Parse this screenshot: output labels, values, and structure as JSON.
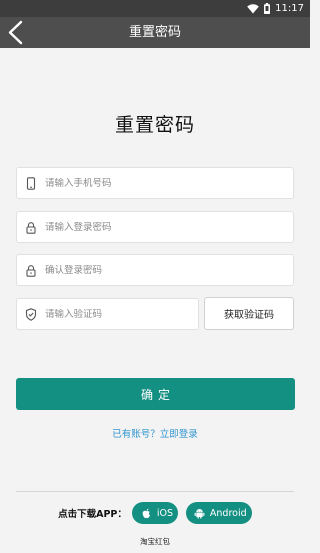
{
  "status_bar": {
    "time": "11:17"
  },
  "nav": {
    "title": "重置密码"
  },
  "heading": "重置密码",
  "form": {
    "phone": {
      "value": "",
      "placeholder": "请输入手机号码"
    },
    "password": {
      "value": "",
      "placeholder": "请输入登录密码"
    },
    "confirm_password": {
      "value": "",
      "placeholder": "确认登录密码"
    },
    "code": {
      "value": "",
      "placeholder": "请输入验证码"
    },
    "get_code_label": "获取验证码",
    "submit_label": "确定"
  },
  "login_link": "已有账号？立即登录",
  "download": {
    "label": "点击下载APP：",
    "ios_label": "iOS",
    "android_label": "Android"
  },
  "footer": "淘宝红包",
  "colors": {
    "accent": "#149082",
    "link": "#2f95cf",
    "nav_bg": "#4e4e4e",
    "status_bg": "#3d3d3d",
    "page_bg": "#f3f3f3"
  },
  "icons": {
    "back": "chevron-left-icon",
    "phone": "phone-icon",
    "password": "lock-icon",
    "confirm_password": "lock-icon",
    "code": "shield-check-icon",
    "ios": "apple-icon",
    "android": "android-icon",
    "wifi": "wifi-icon",
    "battery": "battery-icon"
  }
}
